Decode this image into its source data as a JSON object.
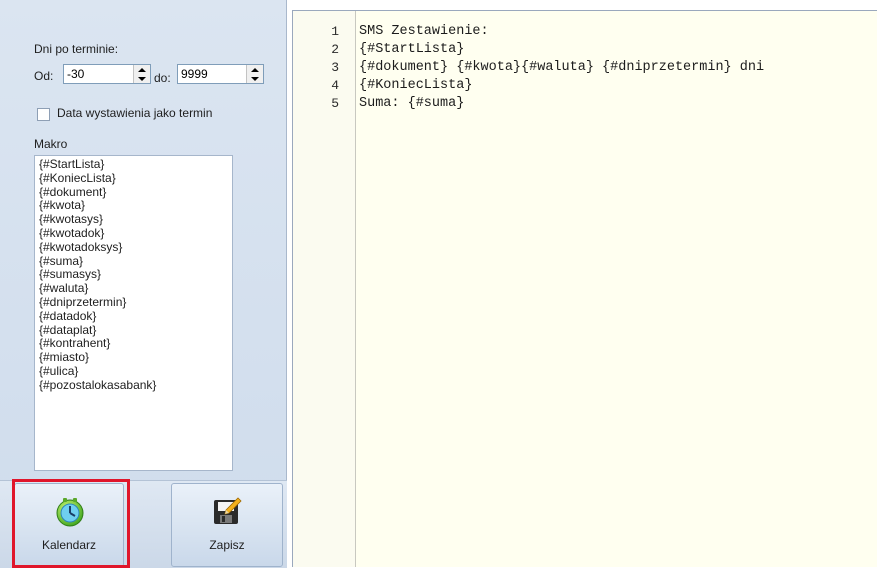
{
  "filters": {
    "days_label": "Dni po terminie:",
    "from_label": "Od:",
    "from_value": "-30",
    "to_label": "do:",
    "to_value": "9999",
    "issue_date_checkbox_label": "Data wystawienia jako termin"
  },
  "macros": {
    "label": "Makro",
    "items": [
      "{#StartLista}",
      "{#KoniecLista}",
      "{#dokument}",
      "{#kwota}",
      "{#kwotasys}",
      "{#kwotadok}",
      "{#kwotadoksys}",
      "{#suma}",
      "{#sumasys}",
      "{#waluta}",
      "{#dniprzetermin}",
      "{#datadok}",
      "{#dataplat}",
      "{#kontrahent}",
      "{#miasto}",
      "{#ulica}",
      "{#pozostalokasabank}"
    ]
  },
  "buttons": {
    "calendar_label": "Kalendarz",
    "save_label": "Zapisz"
  },
  "editor": {
    "line_numbers": [
      "1",
      "2",
      "3",
      "4",
      "5"
    ],
    "lines": [
      "SMS Zestawienie:",
      "{#StartLista}",
      "{#dokument} {#kwota}{#waluta} {#dniprzetermin} dni",
      "{#KoniecLista}",
      "Suma: {#suma}"
    ]
  },
  "colors": {
    "highlight_border": "#e0162b",
    "panel_bg": "#d3dfee",
    "editor_bg": "#fffff0"
  }
}
